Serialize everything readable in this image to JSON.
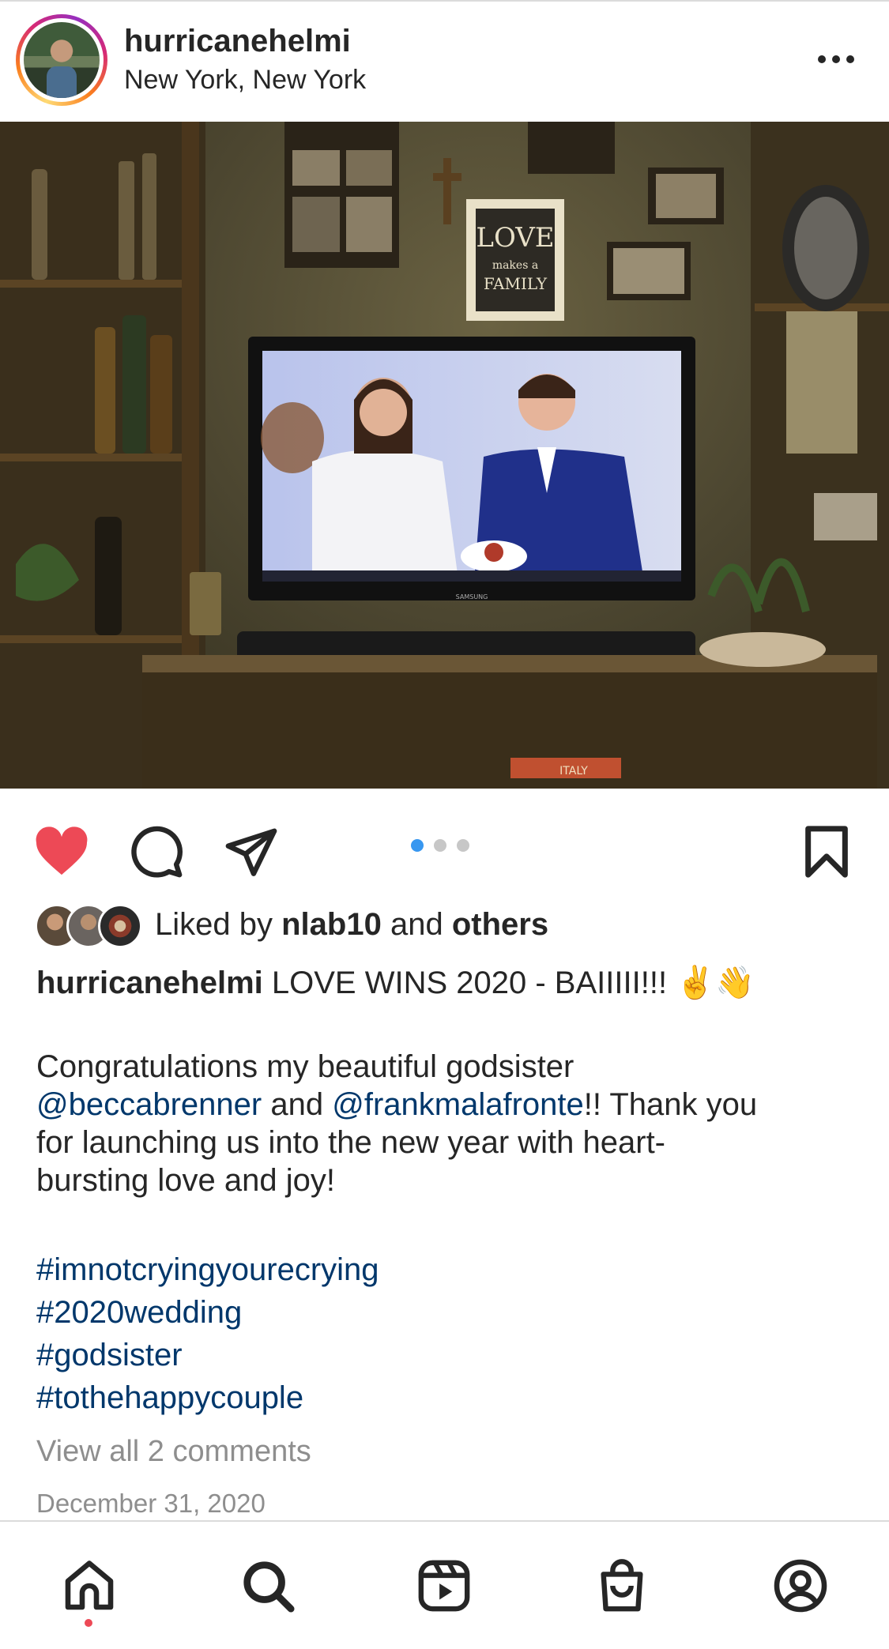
{
  "post": {
    "username": "hurricanehelmi",
    "location": "New York, New York",
    "avatar_icon": "profile-avatar"
  },
  "photo": {
    "description_alt": "",
    "wall_sign_line1": "LOVE",
    "wall_sign_line2": "makes a",
    "wall_sign_line3": "FAMILY",
    "tv_brand": "SAMSUNG",
    "box_label": "ITALY"
  },
  "actions": {
    "like_icon": "heart-filled-icon",
    "comment_icon": "comment-icon",
    "share_icon": "paper-plane-icon",
    "save_icon": "bookmark-icon",
    "carousel_total": 3,
    "carousel_active": 1,
    "liked_color": "#ed4956",
    "active_dot_color": "#3897f0"
  },
  "likes": {
    "prefix": "Liked by",
    "user": "nlab10",
    "conj": "and",
    "others": "others"
  },
  "caption": {
    "username": "hurricanehelmi",
    "headline": "LOVE WINS 2020 - BAIIIII!!!",
    "emoji": "✌️👋",
    "line1": "Congratulations my beautiful godsister",
    "mention1": "@beccabrenner",
    "and": "and",
    "mention2": "@frankmalafronte",
    "line2_tail": "!! Thank you",
    "line3": "for launching us into the new year with heart-",
    "line4": "bursting love and joy!",
    "hashtags": [
      "#imnotcryingyourecrying",
      "#2020wedding",
      "#godsister",
      "#tothehappycouple"
    ]
  },
  "comments_link": "View all 2 comments",
  "date": "December 31, 2020",
  "tabbar": {
    "items": [
      "home-icon",
      "search-icon",
      "reels-icon",
      "shop-icon",
      "profile-icon"
    ],
    "active": "home-icon",
    "indicator_color": "#ed4956"
  },
  "colors": {
    "text": "#262626",
    "link": "#00376b",
    "muted": "#8e8e8e"
  }
}
